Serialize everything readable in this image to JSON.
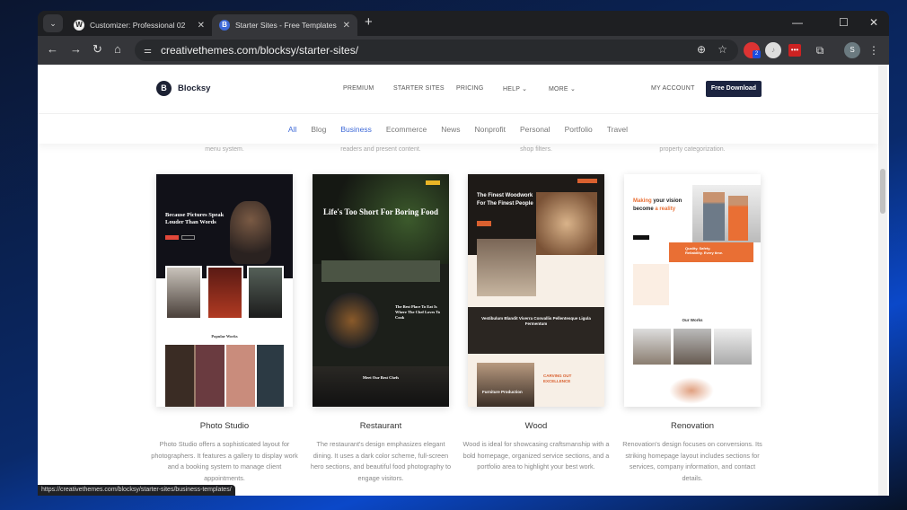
{
  "browser": {
    "tabs": [
      {
        "title": "Customizer: Professional 02",
        "icon": "wordpress-icon",
        "active": false
      },
      {
        "title": "Starter Sites - Free Templates for Wo",
        "icon": "blocksy-icon",
        "active": true
      }
    ],
    "url": "creativethemes.com/blocksy/starter-sites/",
    "extension_badge": "2",
    "profile_initial": "S",
    "status_url": "https://creativethemes.com/blocksy/starter-sites/business-templates/"
  },
  "site": {
    "brand": "Blocksy",
    "brand_mark": "B",
    "nav": [
      "PREMIUM",
      "STARTER SITES",
      "PRICING",
      "HELP",
      "MORE"
    ],
    "my_account": "MY ACCOUNT",
    "cta": "Free Download",
    "accent": "#3f6ad8"
  },
  "filters": {
    "items": [
      "All",
      "Blog",
      "Business",
      "Ecommerce",
      "News",
      "Nonprofit",
      "Personal",
      "Portfolio",
      "Travel"
    ],
    "active": [
      "All",
      "Business"
    ]
  },
  "peek_text": [
    "menu system.",
    "readers and present content.",
    "shop filters.",
    "property categorization."
  ],
  "cards": [
    {
      "title": "Photo Studio",
      "desc": "Photo Studio offers a sophisticated layout for photographers. It features a gallery to display work and a booking system to manage client appointments.",
      "hero": "Because Pictures Speak Louder Than Words",
      "section": "Popular Works"
    },
    {
      "title": "Restaurant",
      "desc": "The restaurant's design emphasizes elegant dining. It uses a dark color scheme, full-screen hero sections, and beautiful food photography to engage visitors.",
      "hero": "Life's Too Short For Boring Food",
      "section": "The Best Place To Eat Is Where The Chef Loves To Cook",
      "footer": "Meet Our Best Chefs"
    },
    {
      "title": "Wood",
      "desc": "Wood is ideal for showcasing craftsmanship with a bold homepage, organized service sections, and a portfolio area to highlight your best work.",
      "hero": "The Finest Woodwork For The Finest People",
      "section": "Vestibulum Blandit Viverra Convallis Pellentesque Ligula Fermentum",
      "footer": "Furniture Production",
      "footer2": "CARVING OUT EXCELLENCE"
    },
    {
      "title": "Renovation",
      "desc": "Renovation's design focuses on conversions. Its striking homepage layout includes sections for services, company information, and contact details.",
      "hero_a": "Making",
      "hero_b": " your vision become ",
      "hero_c": "a reality",
      "band": "Quality. Safety. Reliability. Every time.",
      "section": "Our Works"
    }
  ]
}
